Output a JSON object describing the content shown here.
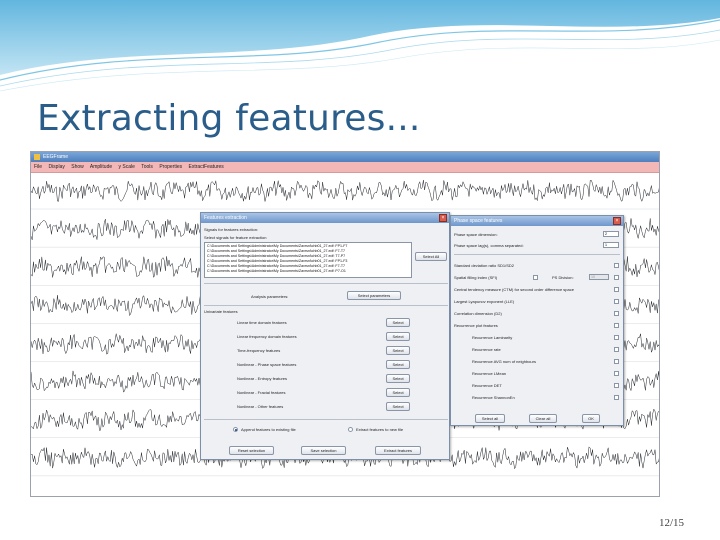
{
  "slide": {
    "title": "Extracting features...",
    "page_number": "12/15"
  },
  "app": {
    "window_title": "EEGFrame",
    "menu": [
      "File",
      "Display",
      "Show",
      "Amplitude",
      "y Scale",
      "Tools",
      "Properties",
      "ExtractFeatures"
    ]
  },
  "features_dialog": {
    "title": "Features extraction",
    "signals_header": "Signals for features extraction:",
    "select_signals_label": "Select signals for feature extraction",
    "files": [
      "C:\\Documents and Settings\\Administrator\\My Documents\\Zavrsni\\chb01_27.edf: FP1-F7",
      "C:\\Documents and Settings\\Administrator\\My Documents\\Zavrsni\\chb01_27.edf: F7-T7",
      "C:\\Documents and Settings\\Administrator\\My Documents\\Zavrsni\\chb01_27.edf: T7-P7",
      "C:\\Documents and Settings\\Administrator\\My Documents\\Zavrsni\\chb01_27.edf: FP1-F3",
      "C:\\Documents and Settings\\Administrator\\My Documents\\Zavrsni\\chb01_27.edf: F7-T7",
      "C:\\Documents and Settings\\Administrator\\My Documents\\Zavrsni\\chb01_27.edf: P7-O1"
    ],
    "select_all_label": "Select All",
    "analysis_parameters_label": "Analysis parameters:",
    "select_parameters_label": "Select parameters",
    "univariate_header": "Univariate features",
    "feature_rows": [
      "Linear time domain features",
      "Linear frequency domain features",
      "Time-frequency features",
      "Nonlinear - Phase space features",
      "Nonlinear - Entropy features",
      "Nonlinear - Fractal features",
      "Nonlinear - Other features"
    ],
    "select_label": "Select",
    "append_option": "Append features to existing file",
    "extract_new_option": "Extract features to new file",
    "reset_label": "Reset selection",
    "save_label": "Save selection",
    "extract_label": "Extract features"
  },
  "phase_dialog": {
    "title": "Phase space features",
    "dimension_label": "Phase space dimension:",
    "dimension_value": "2",
    "lag_label": "Phase space lag(s), comma separated:",
    "lag_value": "1",
    "sd_ratio_label": "Standard deviation ratio SD1/SD2",
    "sfi_label": "Spatial filling index (SFI)",
    "ps_division_label": "PS Division:",
    "ps_division_value": "10",
    "ctm_label": "Central tendency measure (CTM) for second order difference space",
    "lle_label": "Largest Lyapunov exponent (LLE)",
    "d2_label": "Correlation dimension (D2)",
    "recurrence_header": "Recurrence plot features",
    "recurrence_items": [
      "Recurrence Laminarity",
      "Recurrence rate",
      "Recurrence AVG num of neighbours",
      "Recurrence LMean",
      "Recurrence DET",
      "Recurrence ShannonEn"
    ],
    "select_all_label": "Select all",
    "clear_all_label": "Clear all",
    "ok_label": "OK"
  },
  "colors": {
    "title_blue": "#2a5d8a",
    "menubar_pink": "#f4b7b7",
    "dialog_titlebar": "#6f97cb",
    "close_red": "#d85b4b"
  }
}
